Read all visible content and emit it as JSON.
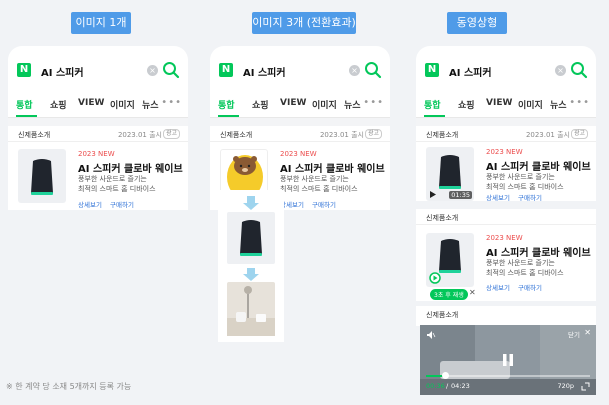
{
  "badges": {
    "image_1": "이미지 1개",
    "image_3": "이미지 3개 (전환효과)",
    "video": "동영상형"
  },
  "search": {
    "query": "AI 스피커",
    "logo": "N",
    "clear": "×"
  },
  "tabs": [
    {
      "label": "통합",
      "active": true
    },
    {
      "label": "쇼핑"
    },
    {
      "label": "VIEW"
    },
    {
      "label": "이미지"
    },
    {
      "label": "뉴스"
    }
  ],
  "more": "•••",
  "card": {
    "label": "신제품소개",
    "date": "2023.01 출시",
    "ad": "광고",
    "new_label": "2023 NEW",
    "title": "AI 스피커 클로바 웨이브",
    "desc1": "풍부한 사운드로 즐기는",
    "desc2": "최적의 스마트 홈 디바이스",
    "link_detail": "상세보기",
    "link_buy": "구매하기"
  },
  "video_card": {
    "duration": "01:35",
    "autoplay_badge": "3초 후 재생",
    "autoplay_close": "✕",
    "close_label": "닫기",
    "current_time": "00:36",
    "total_time": "04:23",
    "quality": "720p",
    "progress": 0.12
  },
  "footnote": "※ 한 계약 당 소재 5개까지 등록 가능",
  "colors": {
    "naver_green": "#03c75a",
    "badge_blue": "#4f9be8",
    "new_red": "#ec4d4d",
    "link_blue": "#2b6fd6"
  }
}
